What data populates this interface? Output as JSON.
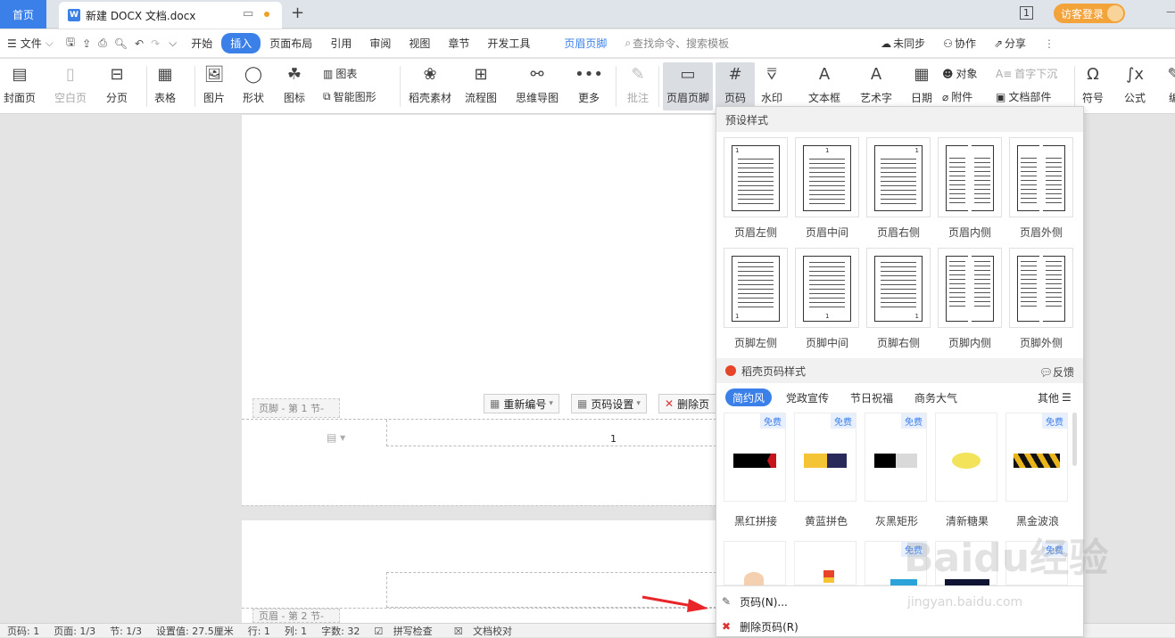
{
  "tabs": {
    "home": "首页",
    "doc_title": "新建 DOCX 文档.docx",
    "new_tab": "+"
  },
  "window": {
    "login": "访客登录",
    "minimize": "—"
  },
  "menubar": {
    "file": "文件",
    "items": [
      "开始",
      "插入",
      "页面布局",
      "引用",
      "审阅",
      "视图",
      "章节",
      "开发工具"
    ],
    "context_tab": "页眉页脚",
    "search_placeholder": "查找命令、搜索模板",
    "sync": "未同步",
    "collab": "协作",
    "share": "分享"
  },
  "ribbon": {
    "cover": "封面页",
    "blank": "空白页",
    "break": "分页",
    "table": "表格",
    "picture": "图片",
    "shape": "形状",
    "icon": "图标",
    "chart": "图表",
    "smartart": "智能图形",
    "materials": "稻壳素材",
    "flowchart": "流程图",
    "mindmap": "思维导图",
    "more": "更多",
    "comment": "批注",
    "header_footer": "页眉页脚",
    "page_number": "页码",
    "watermark": "水印",
    "textbox": "文本框",
    "wordart": "艺术字",
    "date": "日期",
    "object": "对象",
    "attachment": "附件",
    "dropcap": "首字下沉",
    "docparts": "文档部件",
    "symbol": "符号",
    "formula": "公式",
    "edit": "编"
  },
  "document": {
    "footer_tag_1": "页脚  - 第 1 节-",
    "renumber": "重新编号",
    "page_setup": "页码设置",
    "delete_page_number": "删除页",
    "page_num_value": "1",
    "header_tag_2": "页眉  - 第 2 节-"
  },
  "dropdown": {
    "preset_title": "预设样式",
    "presets_header": [
      "页眉左侧",
      "页眉中间",
      "页眉右侧",
      "页眉内侧",
      "页眉外侧"
    ],
    "presets_footer": [
      "页脚左侧",
      "页脚中间",
      "页脚右侧",
      "页脚内侧",
      "页脚外侧"
    ],
    "preset_num": "1",
    "daoke_title": "稻壳页码样式",
    "feedback": "反馈",
    "style_tabs": [
      "简约风",
      "党政宣传",
      "节日祝福",
      "商务大气"
    ],
    "other": "其他",
    "free": "免费",
    "cards": [
      "黑红拼接",
      "黄蓝拼色",
      "灰黑矩形",
      "清新糖果",
      "黑金波浪"
    ],
    "action_page_number": "页码(N)...",
    "action_delete": "删除页码(R)"
  },
  "statusbar": {
    "page": "页码: 1",
    "pages": "页面: 1/3",
    "section": "节: 1/3",
    "position": "设置值: 27.5厘米",
    "row": "行: 1",
    "col": "列: 1",
    "words": "字数: 32",
    "spell": "拼写检查",
    "proof": "文档校对"
  },
  "watermark": {
    "text": "Baidu经验",
    "url": "jingyan.baidu.com"
  },
  "colors": {
    "accent": "#3b7fe8",
    "arrow": "#e8262a"
  }
}
